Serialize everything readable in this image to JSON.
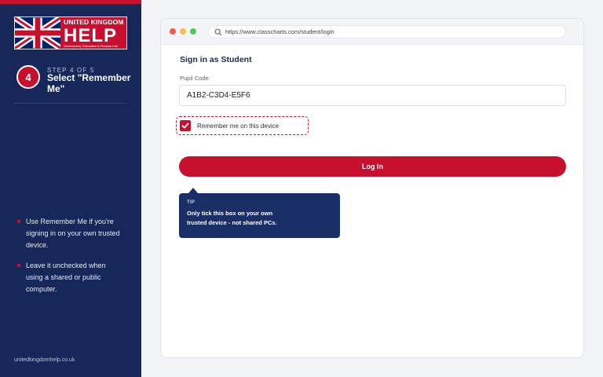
{
  "logo": {
    "line1": "UNITED KINGDOM",
    "line2": "HELP",
    "line3": "Government, Education & Finance Info"
  },
  "step": {
    "number": "4",
    "label": "STEP 4 OF 5",
    "title": "Select \"Remember Me\""
  },
  "sidebar": {
    "bullets": [
      "Use Remember Me if you're signing in on your own trusted device.",
      "Leave it unchecked when using a shared or public computer."
    ],
    "site_url": "unitedkingdomhelp.co.uk"
  },
  "browser": {
    "url": "https://www.classcharts.com/student/login"
  },
  "form": {
    "title": "Sign in as Student",
    "pupil_code_label": "Pupil Code",
    "pupil_code_value": "A1B2-C3D4-E5F6",
    "remember_label": "Remember me on this device",
    "remember_checked": true,
    "login_label": "Log In"
  },
  "tip": {
    "title": "TIP",
    "body": "Only tick this box on your own trusted device - not shared PCs."
  },
  "colors": {
    "brand_red": "#c8102e",
    "sidebar_navy": "#16285a",
    "tip_navy": "#1a2f66"
  }
}
